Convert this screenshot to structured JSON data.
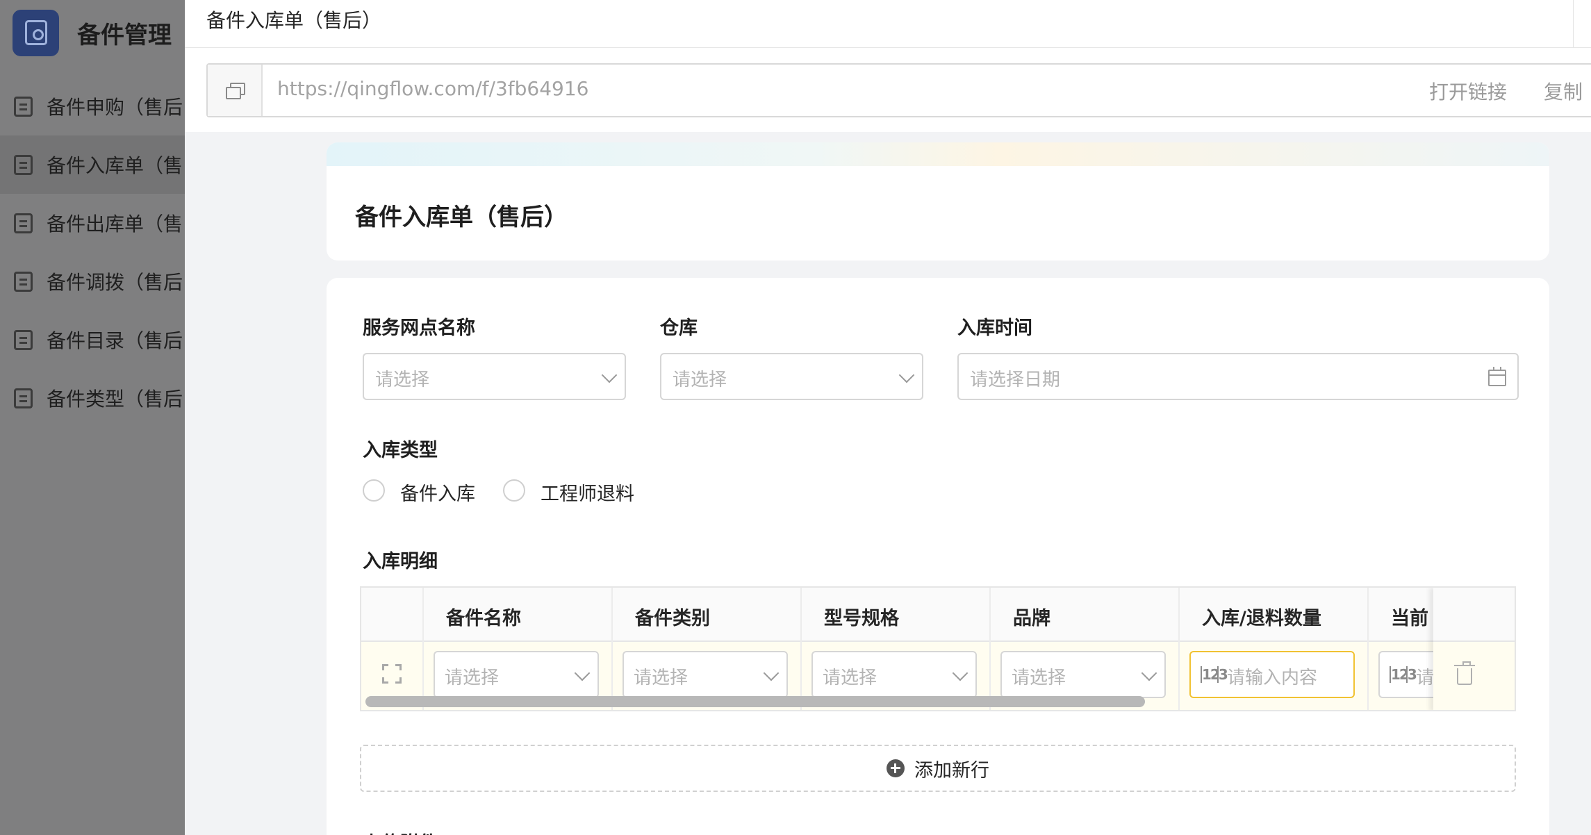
{
  "sidebar": {
    "app_name": "备件管理",
    "items": [
      {
        "label": "备件申购（售后"
      },
      {
        "label": "备件入库单（售"
      },
      {
        "label": "备件出库单（售"
      },
      {
        "label": "备件调拨（售后"
      },
      {
        "label": "备件目录（售后"
      },
      {
        "label": "备件类型（售后"
      }
    ],
    "active_index": 1
  },
  "panel": {
    "title": "备件入库单（售后）",
    "url": "https://qingflow.com/f/3fb64916",
    "open_link": "打开链接",
    "copy": "复制"
  },
  "form": {
    "title": "备件入库单（售后）",
    "fields": {
      "service_point": {
        "label": "服务网点名称",
        "placeholder": "请选择"
      },
      "warehouse": {
        "label": "仓库",
        "placeholder": "请选择"
      },
      "inbound_time": {
        "label": "入库时间",
        "placeholder": "请选择日期"
      },
      "inbound_type": {
        "label": "入库类型",
        "options": [
          "备件入库",
          "工程师退料"
        ]
      }
    },
    "detail": {
      "label": "入库明细",
      "columns": [
        "备件名称",
        "备件类别",
        "型号规格",
        "品牌",
        "入库/退料数量",
        "当前"
      ],
      "row": {
        "name_ph": "请选择",
        "category_ph": "请选择",
        "model_ph": "请选择",
        "brand_ph": "请选择",
        "qty_ph": "请输入内容",
        "current_ph": "请"
      },
      "add_row": "添加新行"
    },
    "next_section_label": "上传附件"
  },
  "colors": {
    "accent_yellow": "#f1c232",
    "sidebar_overlay": "#7f7f80",
    "app_icon": "#2c4177"
  }
}
